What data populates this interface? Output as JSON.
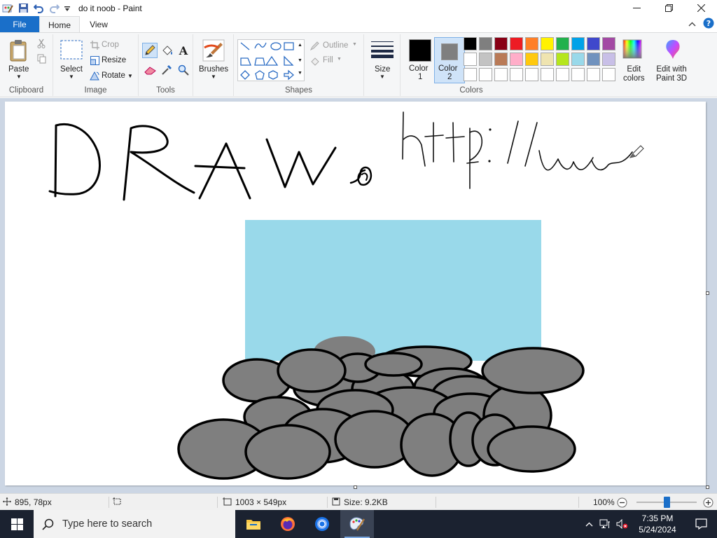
{
  "window": {
    "title": "do it noob - Paint",
    "minimize_icon": "minimize-icon",
    "maximize_icon": "restore-icon",
    "close_icon": "close-icon"
  },
  "tabs": {
    "file": "File",
    "home": "Home",
    "view": "View"
  },
  "ribbon": {
    "clipboard": {
      "paste": "Paste",
      "group": "Clipboard"
    },
    "image": {
      "select": "Select",
      "crop": "Crop",
      "resize": "Resize",
      "rotate": "Rotate",
      "group": "Image"
    },
    "tools": {
      "group": "Tools"
    },
    "brushes": {
      "label": "Brushes"
    },
    "shapes": {
      "outline": "Outline",
      "fill": "Fill",
      "group": "Shapes"
    },
    "size": {
      "label": "Size"
    },
    "colors": {
      "color1_label": "Color",
      "color1_num": "1",
      "color2_label": "Color",
      "color2_num": "2",
      "color1_value": "#000000",
      "color2_value": "#7f7f7f",
      "palette_row1": [
        "#000000",
        "#7f7f7f",
        "#880015",
        "#ed1c24",
        "#ff7f27",
        "#fff200",
        "#22b14c",
        "#00a2e8",
        "#3f48cc",
        "#a349a4"
      ],
      "palette_row2": [
        "#ffffff",
        "#c3c3c3",
        "#b97a57",
        "#ffaec9",
        "#ffc90e",
        "#efe4b0",
        "#b5e61d",
        "#99d9ea",
        "#7092be",
        "#c8bfe7"
      ],
      "palette_row3": [
        "#ffffff",
        "#ffffff",
        "#ffffff",
        "#ffffff",
        "#ffffff",
        "#ffffff",
        "#ffffff",
        "#ffffff",
        "#ffffff",
        "#ffffff"
      ],
      "edit_colors": [
        "Edit",
        "colors"
      ],
      "edit_3d": [
        "Edit with",
        "Paint 3D"
      ],
      "group": "Colors"
    }
  },
  "status": {
    "cursor_pos": "895, 78px",
    "canvas_size": "1003 × 549px",
    "file_size": "Size: 9.2KB",
    "zoom": "100%",
    "zoom_level": 0.5
  },
  "taskbar": {
    "search_placeholder": "Type here to search",
    "time": "7:35 PM",
    "date": "5/24/2024"
  }
}
